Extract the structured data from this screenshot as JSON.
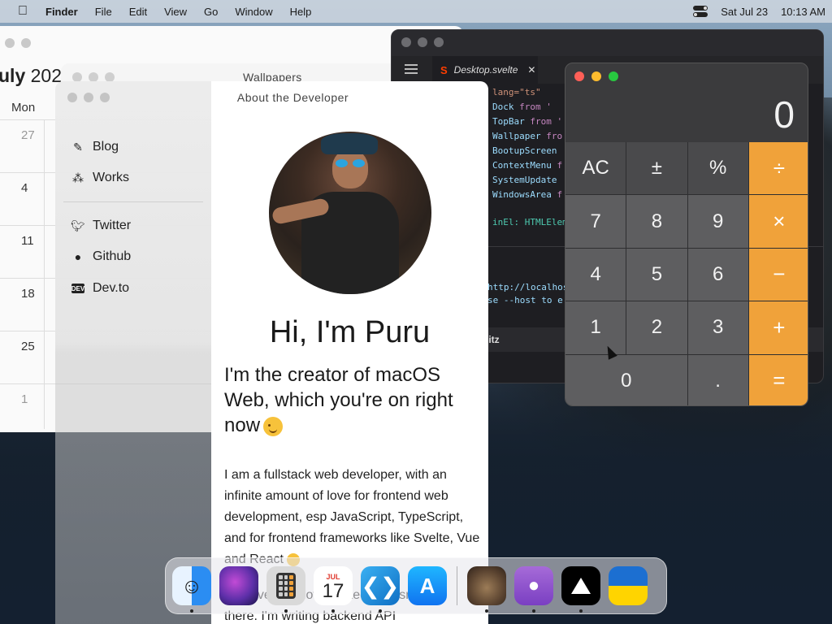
{
  "menubar": {
    "apple_icon": "apple-icon",
    "app_name": "Finder",
    "items": [
      "File",
      "Edit",
      "View",
      "Go",
      "Window",
      "Help"
    ],
    "date": "Sat Jul 23",
    "time": "10:13 AM"
  },
  "calendar": {
    "title_month": "uly",
    "title_year": "202",
    "day_header": "Mon",
    "week_numbers": [
      "27",
      "4",
      "11",
      "18",
      "25",
      "1"
    ]
  },
  "wallpapers_window": {
    "title": "Wallpapers"
  },
  "about_window": {
    "title": "About the Developer",
    "sidebar": [
      {
        "label": "Blog",
        "icon": "pencil-icon"
      },
      {
        "label": "Works",
        "icon": "works-icon"
      },
      {
        "label": "Twitter",
        "icon": "twitter-icon"
      },
      {
        "label": "Github",
        "icon": "github-icon"
      },
      {
        "label": "Dev.to",
        "icon": "devto-icon"
      }
    ],
    "greeting": "Hi, I'm Puru",
    "tagline": "I'm the creator of macOS Web, which you're on right now",
    "bio": "I am a fullstack web developer, with an infinite amount of love for frontend web development, esp JavaScript, TypeScript, and for frontend frameworks like Svelte, Vue and React",
    "bio_more": "However, my love for tech doesn't end there. I'm writing backend API"
  },
  "vscode": {
    "tab_label": "Desktop.svelte",
    "code_lines": [
      {
        "a": "lang=\"ts\"",
        "b": ""
      },
      {
        "a": "Dock",
        "b": " from '"
      },
      {
        "a": "TopBar",
        "b": " from '"
      },
      {
        "a": "Wallpaper",
        "b": " fro"
      },
      {
        "a": "BootupScreen",
        "b": ""
      },
      {
        "a": "ContextMenu",
        "b": " f"
      },
      {
        "a": "SystemUpdate",
        "b": ""
      },
      {
        "a": "WindowsArea",
        "b": " f"
      }
    ],
    "el_line": "inEl: HTMLElem",
    "terminal_1": "http://localhos",
    "terminal_2": "se --host to e",
    "status_label": "litz"
  },
  "calculator": {
    "display": "0",
    "keys": [
      "AC",
      "±",
      "%",
      "÷",
      "7",
      "8",
      "9",
      "×",
      "4",
      "5",
      "6",
      "−",
      "1",
      "2",
      "3",
      "+",
      "0",
      ".",
      "="
    ],
    "colors": {
      "operator": "#f0a23a",
      "function": "#4a4a4c",
      "digit": "#5e5e60"
    }
  },
  "dock": {
    "calendar_month": "JUL",
    "calendar_day": "17",
    "apps": [
      "finder-icon",
      "launchpad-icon",
      "calculator-icon",
      "calendar-icon",
      "vscode-icon",
      "appstore-icon",
      "cat-icon",
      "github-icon",
      "vercel-icon",
      "ukraine-icon"
    ]
  }
}
